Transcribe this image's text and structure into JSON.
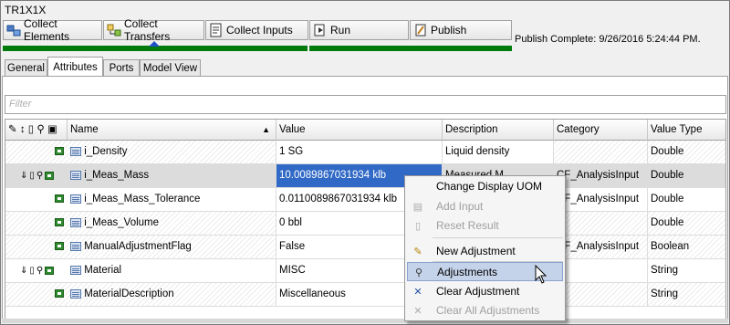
{
  "window": {
    "title": "TR1X1X"
  },
  "toolbar": {
    "collect_elements": "Collect Elements",
    "collect_transfers": "Collect Transfers",
    "collect_inputs": "Collect Inputs",
    "run": "Run",
    "publish": "Publish",
    "status": "Publish Complete: 9/26/2016 5:24:44 PM."
  },
  "tabs": [
    "General",
    "Attributes",
    "Ports",
    "Model View"
  ],
  "filter": {
    "placeholder": "Filter"
  },
  "grid": {
    "columns": [
      "Name",
      "Value",
      "Description",
      "Category",
      "Value Type"
    ],
    "rows": [
      {
        "name": "i_Density",
        "value": "1 SG",
        "description": "Liquid density",
        "category": "",
        "type": "Double"
      },
      {
        "name": "i_Meas_Mass",
        "value": "10.0089867031934 klb",
        "description": "Measured M",
        "category": "CF_AnalysisInput",
        "type": "Double"
      },
      {
        "name": "i_Meas_Mass_Tolerance",
        "value": "0.0110089867031934 klb",
        "description": "",
        "category": "CF_AnalysisInput",
        "type": "Double"
      },
      {
        "name": "i_Meas_Volume",
        "value": "0 bbl",
        "description": "",
        "category": "",
        "type": "Double"
      },
      {
        "name": "ManualAdjustmentFlag",
        "value": "False",
        "description": "",
        "category": "CF_AnalysisInput",
        "type": "Boolean"
      },
      {
        "name": "Material",
        "value": "MISC",
        "description": "",
        "category": "",
        "type": "String"
      },
      {
        "name": "MaterialDescription",
        "value": "Miscellaneous",
        "description": "",
        "category": "",
        "type": "String"
      }
    ]
  },
  "context_menu": {
    "items": [
      "Change Display UOM",
      "Add Input",
      "Reset Result",
      "New Adjustment",
      "Adjustments",
      "Clear Adjustment",
      "Clear All Adjustments"
    ]
  },
  "colors": {
    "progress": "#007a0a",
    "selection": "#3169c6",
    "menu_highlight": "#c5d3ea"
  }
}
